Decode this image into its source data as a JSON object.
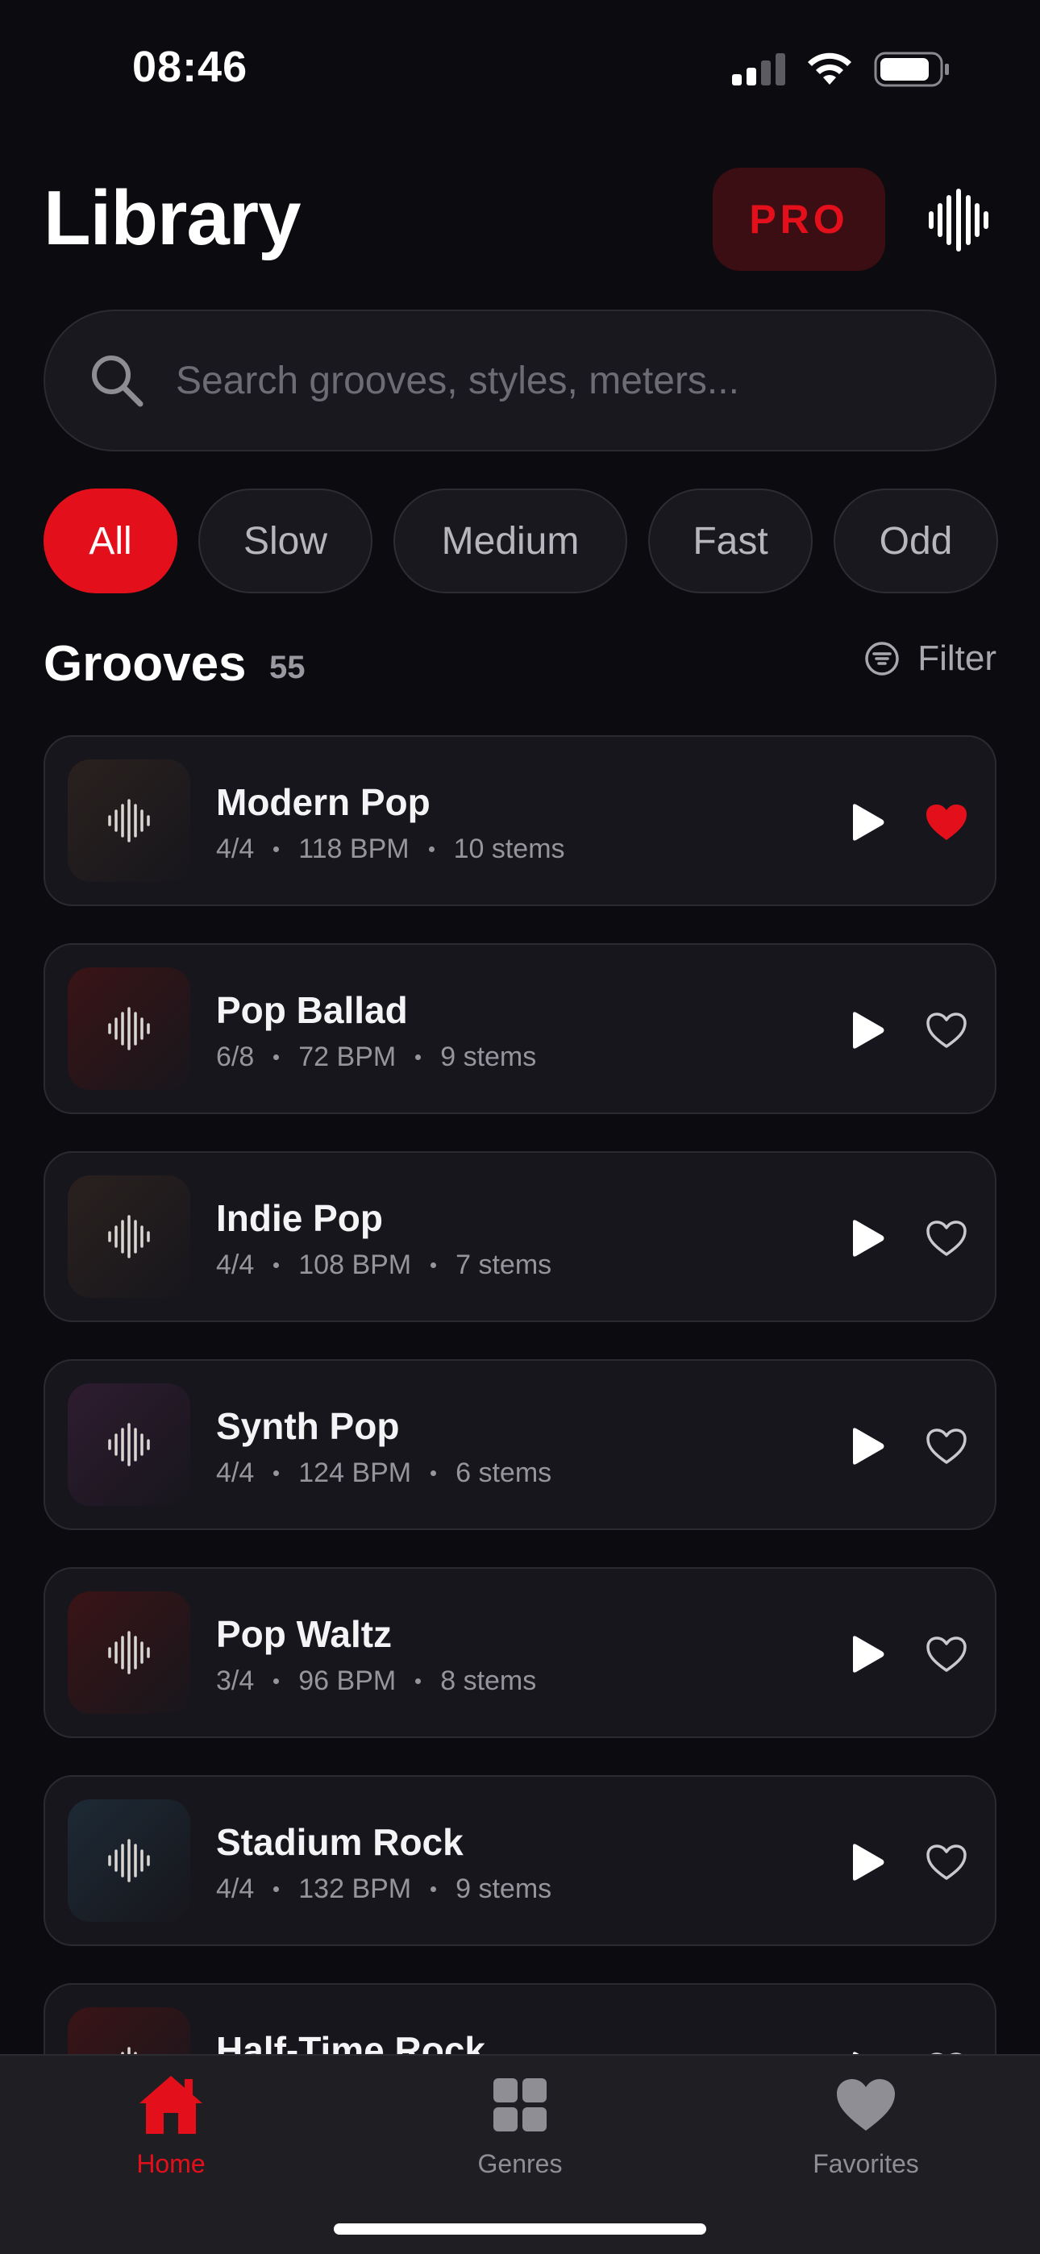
{
  "status_bar": {
    "time": "08:46"
  },
  "header": {
    "title": "Library",
    "pro_label": "PRO"
  },
  "search": {
    "placeholder": "Search grooves, styles, meters..."
  },
  "chips": [
    "All",
    "Slow",
    "Medium",
    "Fast",
    "Odd"
  ],
  "active_chip": "All",
  "section": {
    "title": "Grooves",
    "count": "55",
    "filter_label": "Filter"
  },
  "grooves": [
    {
      "name": "Modern Pop",
      "meter": "4/4",
      "bpm": "118 BPM",
      "stems": "10 stems",
      "favorite": true,
      "thumb": "#2a211e"
    },
    {
      "name": "Pop Ballad",
      "meter": "6/8",
      "bpm": "72 BPM",
      "stems": "9 stems",
      "favorite": false,
      "thumb": "#3a1416"
    },
    {
      "name": "Indie Pop",
      "meter": "4/4",
      "bpm": "108 BPM",
      "stems": "7 stems",
      "favorite": false,
      "thumb": "#2a211e"
    },
    {
      "name": "Synth Pop",
      "meter": "4/4",
      "bpm": "124 BPM",
      "stems": "6 stems",
      "favorite": false,
      "thumb": "#2e1c30"
    },
    {
      "name": "Pop Waltz",
      "meter": "3/4",
      "bpm": "96 BPM",
      "stems": "8 stems",
      "favorite": false,
      "thumb": "#3a1416"
    },
    {
      "name": "Stadium Rock",
      "meter": "4/4",
      "bpm": "132 BPM",
      "stems": "9 stems",
      "favorite": false,
      "thumb": "#1d2a35"
    },
    {
      "name": "Half-Time Rock",
      "meter": "",
      "bpm": "",
      "stems": "",
      "favorite": false,
      "thumb": "#3a1416"
    }
  ],
  "tabs": [
    {
      "label": "Home",
      "icon": "home-icon",
      "active": true
    },
    {
      "label": "Genres",
      "icon": "grid-icon",
      "active": false
    },
    {
      "label": "Favorites",
      "icon": "heart-icon",
      "active": false
    }
  ],
  "colors": {
    "accent": "#e3101c",
    "background": "#0c0b0f",
    "card": "#17161c"
  }
}
